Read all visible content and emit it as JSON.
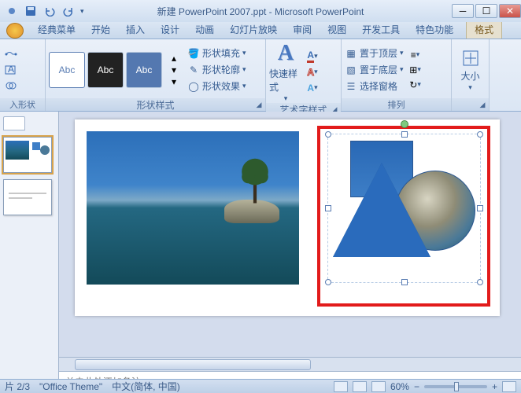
{
  "titlebar": {
    "title": "新建 PowerPoint 2007.ppt - Microsoft PowerPoint"
  },
  "tabs": {
    "items": [
      "经典菜单",
      "开始",
      "插入",
      "设计",
      "动画",
      "幻灯片放映",
      "审阅",
      "视图",
      "开发工具",
      "特色功能"
    ],
    "contextual": "格式"
  },
  "ribbon": {
    "g_insertshape": "入形状",
    "g_shapestyle": "形状样式",
    "style_sample": "Abc",
    "fill": "形状填充",
    "outline": "形状轮廓",
    "effects": "形状效果",
    "quickstyle": "快速样式",
    "g_wordart": "艺术字样式",
    "g_arrange": "排列",
    "bring_front": "置于顶层",
    "send_back": "置于底层",
    "selection_pane": "选择窗格",
    "g_size": "大小"
  },
  "notes": {
    "placeholder": "单击此处添加备注"
  },
  "status": {
    "slide": "片 2/3",
    "theme": "\"Office Theme\"",
    "lang": "中文(简体, 中国)",
    "zoom": "60%"
  }
}
